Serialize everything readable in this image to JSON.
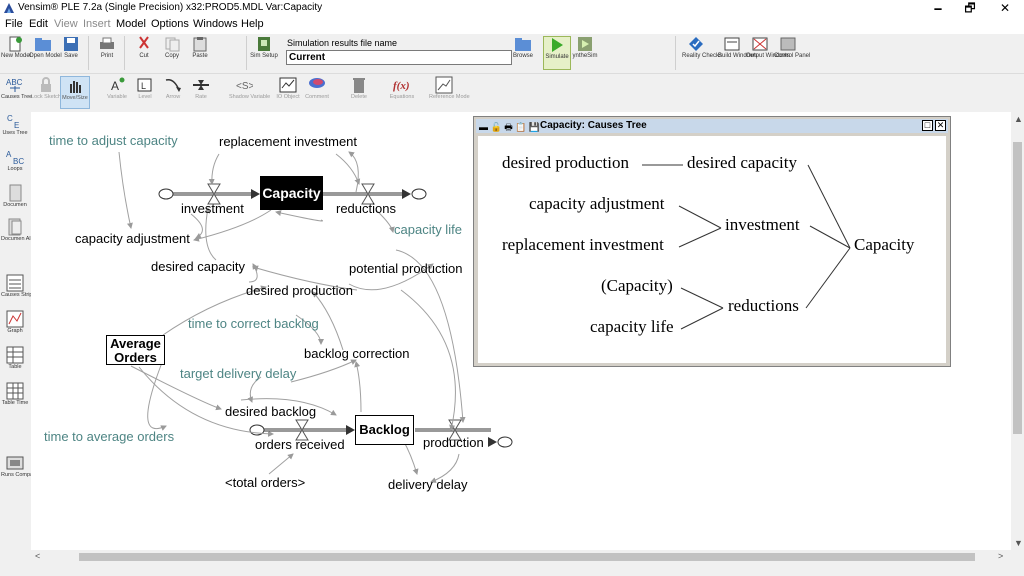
{
  "window": {
    "title": "Vensim® PLE 7.2a (Single Precision) x32:PROD5.MDL Var:Capacity",
    "minimize": "🗕",
    "restore": "🗗",
    "close": "✕"
  },
  "menu": [
    {
      "label": "File",
      "enabled": true
    },
    {
      "label": "Edit",
      "enabled": true
    },
    {
      "label": "View",
      "enabled": false
    },
    {
      "label": "Insert",
      "enabled": false
    },
    {
      "label": "Model",
      "enabled": true
    },
    {
      "label": "Options",
      "enabled": true
    },
    {
      "label": "Windows",
      "enabled": true
    },
    {
      "label": "Help",
      "enabled": true
    }
  ],
  "toolbar": {
    "new_model": "New Model",
    "open_model": "Open Model",
    "save": "Save",
    "print": "Print",
    "cut": "Cut",
    "copy": "Copy",
    "paste": "Paste",
    "sim_setup": "Sim Setup",
    "sim_file_label": "Simulation results file name",
    "sim_file_value": "Current",
    "browse": "Browse",
    "simulate": "Simulate",
    "synthesim": "yntheSim",
    "reality_checks": "Reality Checks",
    "build_windows": "Build Windows",
    "output_windows": "Output Windows",
    "control_panel": "Control Panel"
  },
  "toolbar2": {
    "lock_sketch": "Lock Sketch",
    "move_size": "Move/Size",
    "variable": "Variable",
    "level": "Level",
    "arrow": "Arrow",
    "rate": "Rate",
    "shadow_variable": "Shadow Variable",
    "io_object": "IO Object",
    "comment": "Comment",
    "delete": "Delete",
    "equations": "Equations",
    "reference_mode": "Reference Mode"
  },
  "left_tools": {
    "causes_tree": "Causes Tree",
    "uses_tree": "Uses Tree",
    "loops": "Loops",
    "document": "Documen",
    "document_all": "Documen All",
    "causes_strip": "Causes Strip",
    "graph": "Graph",
    "table": "Table",
    "table_time": "Table Time",
    "runs_compare": "Runs Compare"
  },
  "diagram": {
    "capacity": "Capacity",
    "investment": "investment",
    "reductions": "reductions",
    "replacement_investment": "replacement investment",
    "time_to_adjust_capacity": "time to adjust capacity",
    "capacity_adjustment": "capacity adjustment",
    "desired_capacity": "desired capacity",
    "capacity_life": "capacity life",
    "potential_production": "potential production",
    "desired_production": "desired production",
    "time_to_correct_backlog": "time to correct backlog",
    "average_orders_line1": "Average",
    "average_orders_line2": "Orders",
    "backlog_correction": "backlog correction",
    "target_delivery_delay": "target delivery delay",
    "desired_backlog": "desired backlog",
    "time_to_average_orders": "time to average orders",
    "backlog": "Backlog",
    "orders_received": "orders received",
    "production": "production",
    "total_orders": "<total orders>",
    "delivery_delay": "delivery delay"
  },
  "causes_tree": {
    "title": "Capacity: Causes Tree",
    "icons": "▬ 🔓 🖶 📋 💾",
    "maximize": "□",
    "close": "✕",
    "desired_production": "desired production",
    "desired_capacity": "desired capacity",
    "capacity_adjustment": "capacity adjustment",
    "investment": "investment",
    "replacement_investment": "replacement investment",
    "capacity_paren": "(Capacity)",
    "reductions": "reductions",
    "capacity_life": "capacity life",
    "root": "Capacity"
  },
  "scroll": {
    "up": "▲",
    "down": "▼",
    "left": "<",
    "right": ">"
  },
  "colors": {
    "constant_text": "#4e8584",
    "arrow": "#a0a0a0",
    "selected_stock": "#000000",
    "titlebar_tree": "#c8d8ea"
  }
}
